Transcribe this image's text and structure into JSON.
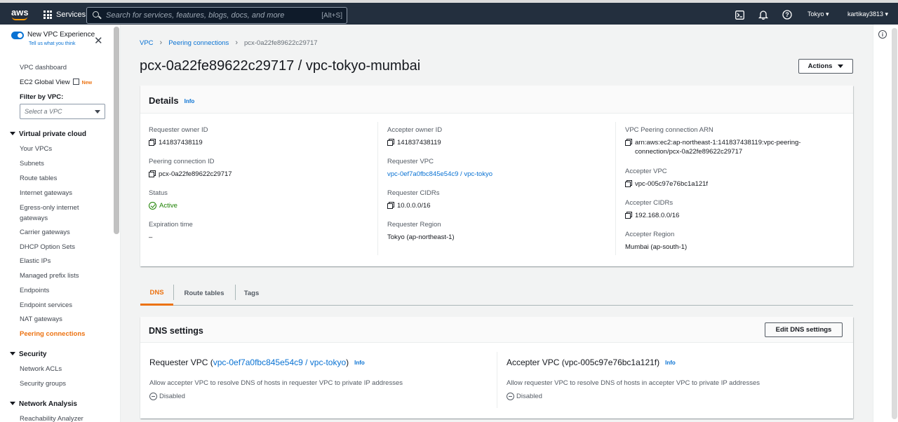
{
  "topbar": {
    "logo": "aws",
    "services_label": "Services",
    "search_placeholder": "Search for services, features, blogs, docs, and more",
    "search_shortcut": "[Alt+S]",
    "region": "Tokyo ▾",
    "user": "kartikay3813 ▾",
    "icons": [
      "cloudshell-icon",
      "bell-icon",
      "help-icon"
    ]
  },
  "sidebar": {
    "toggle_label": "New VPC Experience",
    "toggle_sub": "Tell us what you think",
    "dashboard": "VPC dashboard",
    "global_view": "EC2 Global View",
    "global_view_badge": "New",
    "filter_label": "Filter by VPC:",
    "filter_placeholder": "Select a VPC",
    "sections": {
      "vpc": "Virtual private cloud",
      "security": "Security",
      "network": "Network Analysis"
    },
    "vpc_items": [
      "Your VPCs",
      "Subnets",
      "Route tables",
      "Internet gateways",
      "Egress-only internet",
      "gateways",
      "Carrier gateways",
      "DHCP Option Sets",
      "Elastic IPs",
      "Managed prefix lists",
      "Endpoints",
      "Endpoint services",
      "NAT gateways",
      "Peering connections"
    ],
    "security_items": [
      "Network ACLs",
      "Security groups"
    ],
    "network_items": [
      "Reachability Analyzer"
    ]
  },
  "breadcrumb": [
    "VPC",
    "Peering connections",
    "pcx-0a22fe89622c29717"
  ],
  "page_title": "pcx-0a22fe89622c29717 / vpc-tokyo-mumbai",
  "actions_label": "Actions",
  "details": {
    "title": "Details",
    "info": "Info",
    "col1": [
      {
        "label": "Requester owner ID",
        "value": "141837438119"
      },
      {
        "label": "Peering connection ID",
        "value": "pcx-0a22fe89622c29717"
      },
      {
        "label": "Status",
        "value": "Active"
      },
      {
        "label": "Expiration time",
        "value": "–"
      }
    ],
    "col2": [
      {
        "label": "Accepter owner ID",
        "value": "141837438119"
      },
      {
        "label": "Requester VPC",
        "value": "vpc-0ef7a0fbc845e54c9 / vpc-tokyo"
      },
      {
        "label": "Requester CIDRs",
        "value": "10.0.0.0/16"
      },
      {
        "label": "Requester Region",
        "value": "Tokyo (ap-northeast-1)"
      }
    ],
    "col3": [
      {
        "label": "VPC Peering connection ARN",
        "value_line1": "arn:aws:ec2:ap-northeast-1:141837438119:vpc-peering-",
        "value_line2": "connection/pcx-0a22fe89622c29717"
      },
      {
        "label": "Accepter VPC",
        "value": "vpc-005c97e76bc1a121f"
      },
      {
        "label": "Accepter CIDRs",
        "value": "192.168.0.0/16"
      },
      {
        "label": "Accepter Region",
        "value": "Mumbai (ap-south-1)"
      }
    ]
  },
  "tabs": [
    "DNS",
    "Route tables",
    "Tags"
  ],
  "dns": {
    "title": "DNS settings",
    "edit_label": "Edit DNS settings",
    "requester": {
      "prefix": "Requester VPC (",
      "link": "vpc-0ef7a0fbc845e54c9 / vpc-tokyo",
      "suffix": ")",
      "info": "Info",
      "desc": "Allow accepter VPC to resolve DNS of hosts in requester VPC to private IP addresses",
      "status": "Disabled"
    },
    "accepter": {
      "title": "Accepter VPC (vpc-005c97e76bc1a121f)",
      "info": "Info",
      "desc": "Allow requester VPC to resolve DNS of hosts in accepter VPC to private IP addresses",
      "status": "Disabled"
    }
  },
  "colors": {
    "accent": "#ec7211",
    "link": "#0972d3",
    "success": "#1d8102",
    "nav_bg": "#232f3e"
  }
}
